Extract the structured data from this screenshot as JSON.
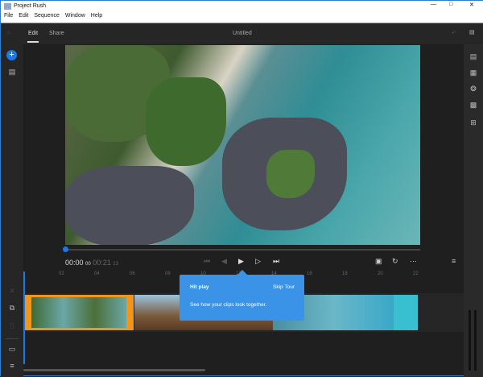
{
  "window": {
    "title": "Project Rush",
    "controls": [
      "minimize",
      "maximize",
      "close"
    ]
  },
  "menu": [
    "File",
    "Edit",
    "Sequence",
    "Window",
    "Help"
  ],
  "appbar": {
    "tabs": [
      "Edit",
      "Share"
    ],
    "active_tab": "Edit",
    "project_title": "Untitled"
  },
  "player": {
    "current_time": "00:00",
    "current_frames": "00",
    "duration": "00:21",
    "duration_frames": "13",
    "progress": 0
  },
  "timeline": {
    "ticks": [
      "02",
      "04",
      "06",
      "08",
      "10",
      "12",
      "14",
      "16",
      "18",
      "20",
      "22"
    ]
  },
  "tour": {
    "title": "Hit play",
    "skip": "Skip Tour",
    "body": "See how your clips look together."
  },
  "colors": {
    "accent": "#1e78e6",
    "selected_clip": "#f0961e",
    "tooltip": "#3a93e6"
  }
}
